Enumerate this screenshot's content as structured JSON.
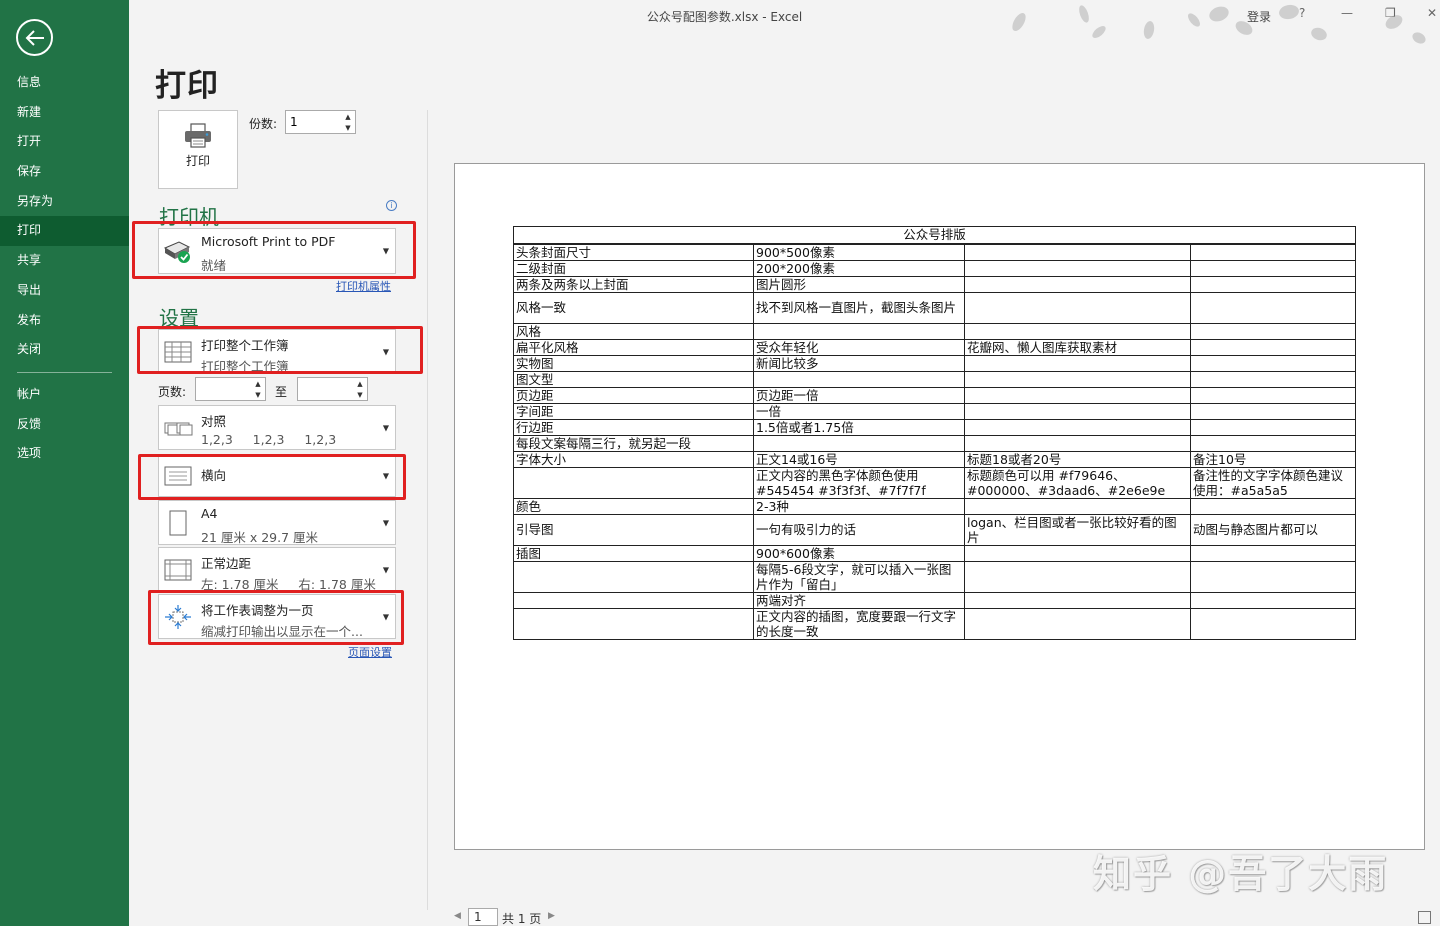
{
  "window": {
    "title": "公众号配图参数.xlsx  -  Excel",
    "login": "登录",
    "help": "?",
    "minimize": "—",
    "restore": "❐",
    "close": "✕"
  },
  "sidebar": {
    "items": [
      {
        "label": "信息"
      },
      {
        "label": "新建"
      },
      {
        "label": "打开"
      },
      {
        "label": "保存"
      },
      {
        "label": "另存为"
      },
      {
        "label": "打印"
      },
      {
        "label": "共享"
      },
      {
        "label": "导出"
      },
      {
        "label": "发布"
      },
      {
        "label": "关闭"
      }
    ],
    "items2": [
      {
        "label": "帐户"
      },
      {
        "label": "反馈"
      },
      {
        "label": "选项"
      }
    ],
    "active": "打印"
  },
  "print": {
    "page_title": "打印",
    "print_button": "打印",
    "copies_label": "份数:",
    "copies_value": "1",
    "printer_heading": "打印机",
    "printer_name": "Microsoft Print to PDF",
    "printer_status": "就绪",
    "printer_properties": "打印机属性",
    "settings_heading": "设置",
    "scope_title": "打印整个工作簿",
    "scope_sub": "打印整个工作簿",
    "pages_label": "页数:",
    "to_label": "至",
    "collate_title": "对照",
    "collate_sub": "1,2,3     1,2,3     1,2,3",
    "orientation": "横向",
    "paper_title": "A4",
    "paper_sub": "21 厘米 x 29.7 厘米",
    "margins_title": "正常边距",
    "margins_sub": "左: 1.78 厘米     右: 1.78 厘米",
    "scaling_title": "将工作表调整为一页",
    "scaling_sub": "缩减打印输出以显示在一个...",
    "page_setup": "页面设置"
  },
  "preview": {
    "caption": "公众号排版",
    "rows": [
      [
        "头条封面尺寸",
        "900*500像素",
        "",
        ""
      ],
      [
        "二级封面",
        "200*200像素",
        "",
        ""
      ],
      [
        "两条及两条以上封面",
        "图片圆形",
        "",
        ""
      ],
      [
        "风格一致",
        "找不到风格一直图片，截图头条图片",
        "",
        ""
      ],
      [
        "风格",
        "",
        "",
        ""
      ],
      [
        "扁平化风格",
        "受众年轻化",
        "花瓣网、懒人图库获取素材",
        ""
      ],
      [
        "实物图",
        "新闻比较多",
        "",
        ""
      ],
      [
        "图文型",
        "",
        "",
        ""
      ],
      [
        "页边距",
        "页边距一倍",
        "",
        ""
      ],
      [
        "字间距",
        "一倍",
        "",
        ""
      ],
      [
        "行边距",
        "1.5倍或者1.75倍",
        "",
        ""
      ],
      [
        "每段文案每隔三行，就另起一段",
        "",
        "",
        ""
      ],
      [
        "字体大小",
        "正文14或16号",
        "标题18或者20号",
        "备注10号"
      ],
      [
        "",
        "正文内容的黑色字体颜色使用#545454 #3f3f3f、#7f7f7f",
        "标题颜色可以用 #f79646、#000000、#3daad6、#2e6e9e",
        "备注性的文字字体颜色建议使用：#a5a5a5"
      ],
      [
        "颜色",
        "2-3种",
        "",
        ""
      ],
      [
        "引导图",
        "一句有吸引力的话",
        "logan、栏目图或者一张比较好看的图片",
        "动图与静态图片都可以"
      ],
      [
        "插图",
        "900*600像素",
        "",
        ""
      ],
      [
        "",
        "每隔5-6段文字，就可以插入一张图片作为「留白」",
        "",
        ""
      ],
      [
        "",
        "两端对齐",
        "",
        ""
      ],
      [
        "",
        "正文内容的插图，宽度要跟一行文字的长度一致",
        "",
        ""
      ]
    ]
  },
  "pager": {
    "current": "1",
    "total": "共 1 页"
  },
  "watermark": "知乎 @吾了大雨",
  "colors": {
    "sidebar": "#217346",
    "sidebar_active": "#0e5c30",
    "highlight": "#e02020",
    "link": "#2856b6"
  }
}
